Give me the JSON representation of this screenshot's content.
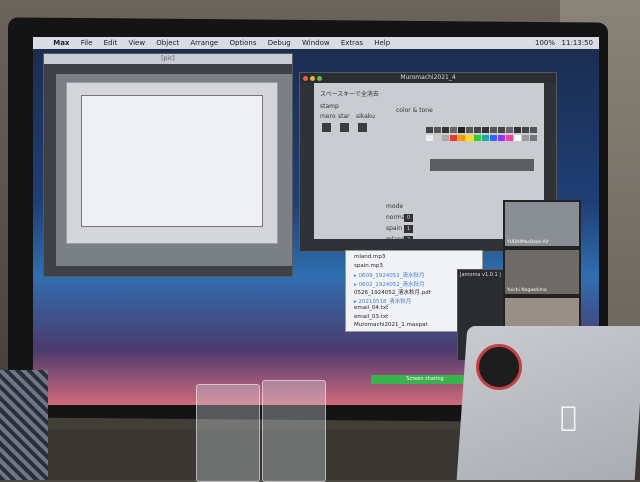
{
  "menubar": {
    "items": [
      "Max",
      "File",
      "Edit",
      "View",
      "Object",
      "Arrange",
      "Options",
      "Debug",
      "Window",
      "Extras",
      "Help"
    ],
    "zoom": "100%",
    "clock": "11:13:50"
  },
  "win1": {
    "title": "[pic]"
  },
  "win2": {
    "title": "Muromachi2021_4",
    "heading": "スペースキーで全消去",
    "stamp_label": "stamp",
    "stamp_items": [
      "mero",
      "star",
      "sikaku"
    ],
    "color_label": "color & tone",
    "mode_label": "mode",
    "modes": [
      {
        "label": "normal",
        "value": "0"
      },
      {
        "label": "spain",
        "value": "1"
      },
      {
        "label": "mland",
        "value": "2"
      }
    ]
  },
  "files": [
    {
      "name": "mland.mp3",
      "folder": false
    },
    {
      "name": "spain.mp3",
      "folder": false
    },
    {
      "name": "0609_1924052_清水秋月",
      "folder": true
    },
    {
      "name": "0602_1924052_清水秋月",
      "folder": true
    },
    {
      "name": "0526_1924052_清水秋月.pdf",
      "folder": false
    },
    {
      "name": "20210518_清水秋月",
      "folder": true
    },
    {
      "name": "email_04.txt",
      "folder": false
    },
    {
      "name": "email_03.txt",
      "folder": false
    },
    {
      "name": "Muromachi2021_1.maxpat",
      "folder": false
    }
  ],
  "video": {
    "participants": [
      "YUDAIMacBook-Air",
      "Yuichi Nagashima",
      ""
    ]
  },
  "jamoma": {
    "title": "Jamoma v1.0.1 | Ne"
  },
  "banner": {
    "text": "Screen sharing"
  },
  "colors": {
    "share_green": "#37b24d",
    "desktop_top": "#1b2c4e",
    "desktop_bottom": "#d26a7a"
  }
}
